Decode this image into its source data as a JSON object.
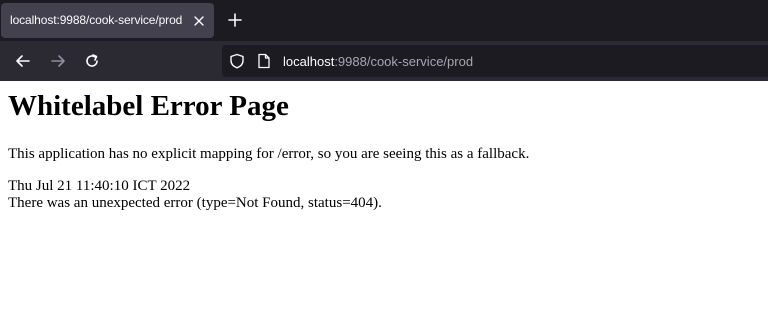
{
  "browser": {
    "tab": {
      "title": "localhost:9988/cook-service/prod"
    },
    "address": {
      "host": "localhost",
      "rest": ":9988/cook-service/prod"
    }
  },
  "page": {
    "heading": "Whitelabel Error Page",
    "message": "This application has no explicit mapping for /error, so you are seeing this as a fallback.",
    "timestamp": "Thu Jul 21 11:40:10 ICT 2022",
    "error": "There was an unexpected error (type=Not Found, status=404)."
  },
  "icons": {
    "tab_close": "close-icon",
    "new_tab": "plus-icon",
    "back": "arrow-left-icon",
    "forward": "arrow-right-icon",
    "reload": "reload-icon",
    "tracking": "shield-icon",
    "page_info": "page-icon"
  },
  "colors": {
    "tabstrip_bg": "#1c1b22",
    "active_tab_bg": "#42414d",
    "toolbar_bg": "#2b2a33",
    "urlbar_bg": "#1c1b22"
  }
}
